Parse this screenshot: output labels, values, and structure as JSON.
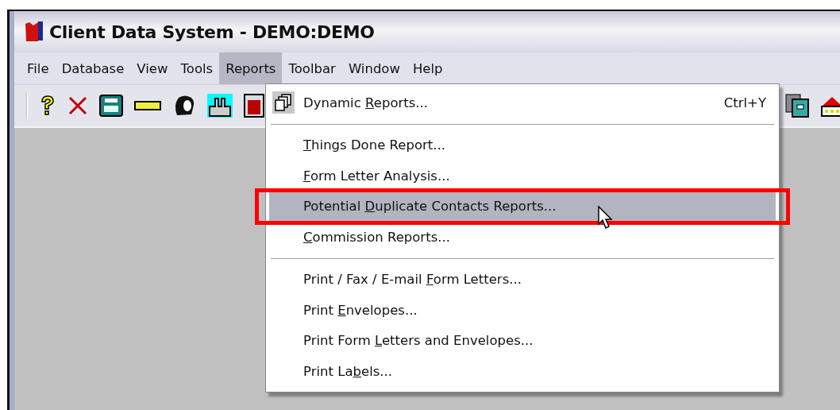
{
  "window": {
    "title": "Client Data System - DEMO:DEMO"
  },
  "menu_bar": [
    {
      "label": "File",
      "selected": false
    },
    {
      "label": "Database",
      "selected": false
    },
    {
      "label": "View",
      "selected": false
    },
    {
      "label": "Tools",
      "selected": false
    },
    {
      "label": "Reports",
      "selected": true
    },
    {
      "label": "Toolbar",
      "selected": false
    },
    {
      "label": "Window",
      "selected": false
    },
    {
      "label": "Help",
      "selected": false
    }
  ],
  "dropdown": [
    {
      "kind": "item",
      "label": {
        "before": "Dynamic ",
        "key": "R",
        "after": "eports..."
      },
      "shortcut": "Ctrl+Y",
      "icon": true,
      "selected": false
    },
    {
      "kind": "separator"
    },
    {
      "kind": "item",
      "label": {
        "key": "T",
        "after": "hings Done Report..."
      },
      "selected": false
    },
    {
      "kind": "item",
      "label": {
        "key": "F",
        "after": "orm Letter Analysis..."
      },
      "selected": false
    },
    {
      "kind": "item",
      "label": {
        "before": "Potential ",
        "key": "D",
        "after": "uplicate Contacts Reports..."
      },
      "selected": true,
      "highlighted": true
    },
    {
      "kind": "item",
      "label": {
        "key": "C",
        "after": "ommission Reports..."
      },
      "selected": false
    },
    {
      "kind": "separator"
    },
    {
      "kind": "item",
      "label": {
        "before": "Print / Fax / E-mail ",
        "key": "F",
        "after": "orm Letters..."
      },
      "selected": false
    },
    {
      "kind": "item",
      "label": {
        "before": "Print ",
        "key": "E",
        "after": "nvelopes..."
      },
      "selected": false
    },
    {
      "kind": "item",
      "label": {
        "before": "Print Form ",
        "key": "L",
        "after": "etters and Envelopes..."
      },
      "selected": false
    },
    {
      "kind": "item",
      "label": {
        "before": "Print La",
        "key": "b",
        "after": "els..."
      },
      "selected": false
    }
  ]
}
